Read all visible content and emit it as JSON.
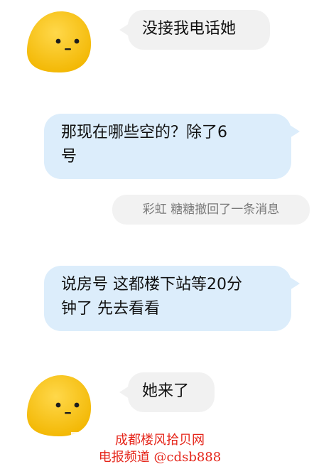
{
  "messages": [
    {
      "side": "incoming",
      "text": "没接我电话她"
    },
    {
      "side": "outgoing",
      "lines": [
        "那现在哪些空的？除了6",
        "号"
      ]
    },
    {
      "side": "system",
      "text": "彩虹 糖糖撤回了一条消息"
    },
    {
      "side": "outgoing",
      "lines": [
        "说房号 这都楼下站等20分",
        "钟了 先去看看"
      ]
    },
    {
      "side": "incoming",
      "text": "她来了"
    }
  ],
  "watermark": {
    "line1": "成都楼风拾贝网",
    "line2": "电报频道 @cdsb888"
  },
  "colors": {
    "avatar": "#f6c000",
    "incoming_bubble": "#f1f1f1",
    "outgoing_bubble": "#dcedfb",
    "watermark": "#e52419"
  }
}
